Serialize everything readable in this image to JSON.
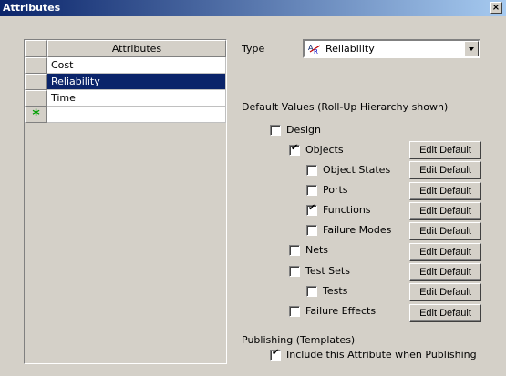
{
  "window": {
    "title": "Attributes",
    "close_label": "×"
  },
  "grid": {
    "header": "Attributes",
    "rows": [
      "Cost",
      "Reliability",
      "Time",
      ""
    ],
    "selected_index": 1,
    "new_row_marker": "*"
  },
  "type_label": "Type",
  "type_value": "Reliability",
  "default_values_label": "Default Values (Roll-Up Hierarchy shown)",
  "tree": [
    {
      "label": "Design",
      "checked": false,
      "has_button": false
    },
    {
      "label": "Objects",
      "checked": true,
      "has_button": true
    },
    {
      "label": "Object States",
      "checked": false,
      "has_button": true
    },
    {
      "label": "Ports",
      "checked": false,
      "has_button": true
    },
    {
      "label": "Functions",
      "checked": true,
      "has_button": true
    },
    {
      "label": "Failure Modes",
      "checked": false,
      "has_button": true
    },
    {
      "label": "Nets",
      "checked": false,
      "has_button": true
    },
    {
      "label": "Test Sets",
      "checked": false,
      "has_button": true
    },
    {
      "label": "Tests",
      "checked": false,
      "has_button": true
    },
    {
      "label": "Failure Effects",
      "checked": false,
      "has_button": true
    }
  ],
  "edit_default_label": "Edit Default",
  "publishing": {
    "label": "Publishing (Templates)",
    "option_label": "Include this Attribute when Publishing",
    "checked": true
  }
}
